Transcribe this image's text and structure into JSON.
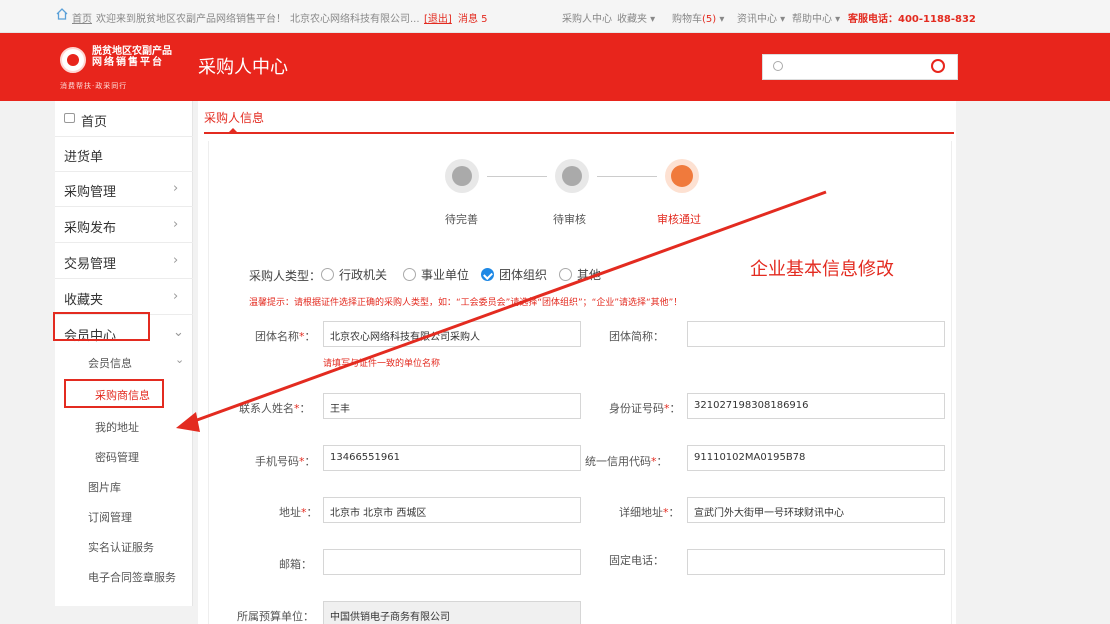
{
  "topbar": {
    "home": "首页",
    "welcome": "欢迎来到脱贫地区农副产品网络销售平台！",
    "company": "北京农心网络科技有限公司...",
    "logout": "[退出]",
    "messages": "消息 5",
    "buyer_center": "采购人中心",
    "favorites": "收藏夹",
    "cart": "购物车",
    "cart_count": "(5)",
    "info_center": "资讯中心",
    "help_center": "帮助中心",
    "hotline": "客服电话：400-1188-832"
  },
  "header": {
    "logo_line1": "脱贫地区农副产品",
    "logo_line2": "网络销售平台",
    "logo_slogan": "消费帮扶·政采同行",
    "title": "采购人中心",
    "search_placeholder": ""
  },
  "sidebar": {
    "home": "首页",
    "items": [
      "进货单",
      "采购管理",
      "采购发布",
      "交易管理",
      "收藏夹",
      "会员中心"
    ],
    "member_sub": {
      "member_info": "会员信息",
      "buyer_info": "采购商信息",
      "my_address": "我的地址",
      "password": "密码管理",
      "gallery": "图片库",
      "subscription": "订阅管理",
      "realname": "实名认证服务",
      "contract": "电子合同签章服务"
    }
  },
  "main": {
    "tab": "采购人信息",
    "steps": [
      "待完善",
      "待审核",
      "审核通过"
    ],
    "buyer_type_label": "采购人类型：",
    "buyer_types": [
      "行政机关",
      "事业单位",
      "团体组织",
      "其他"
    ],
    "selected_type": "团体组织",
    "hint": "温馨提示：请根据证件选择正确的采购人类型，如：“工会委员会”请选择“团体组织”；“企业”请选择“其他”！",
    "annotation": "企业基本信息修改",
    "fields": {
      "org_name_label": "团体名称",
      "org_name_value": "北京农心网络科技有限公司采购人",
      "org_name_tip": "请填写与证件一致的单位名称",
      "org_short_label": "团体简称：",
      "org_short_value": "",
      "contact_label": "联系人姓名",
      "contact_value": "王丰",
      "id_label": "身份证号码",
      "id_value": "321027198308186916",
      "phone_label": "手机号码",
      "phone_value": "13466551961",
      "credit_label": "统一信用代码",
      "credit_value": "91110102MA0195B78",
      "address_label": "地址",
      "address_value": "北京市 北京市 西城区",
      "detail_label": "详细地址",
      "detail_value": "宣武门外大街甲一号环球财讯中心",
      "email_label": "邮箱：",
      "email_value": "",
      "tel_label": "固定电话：",
      "tel_value": "",
      "budget_label": "所属预算单位：",
      "budget_value": "中国供销电子商务有限公司"
    }
  },
  "colors": {
    "brand_red": "#e8251c",
    "active_step": "#f07a3c",
    "checked_blue": "#1e88e5"
  }
}
